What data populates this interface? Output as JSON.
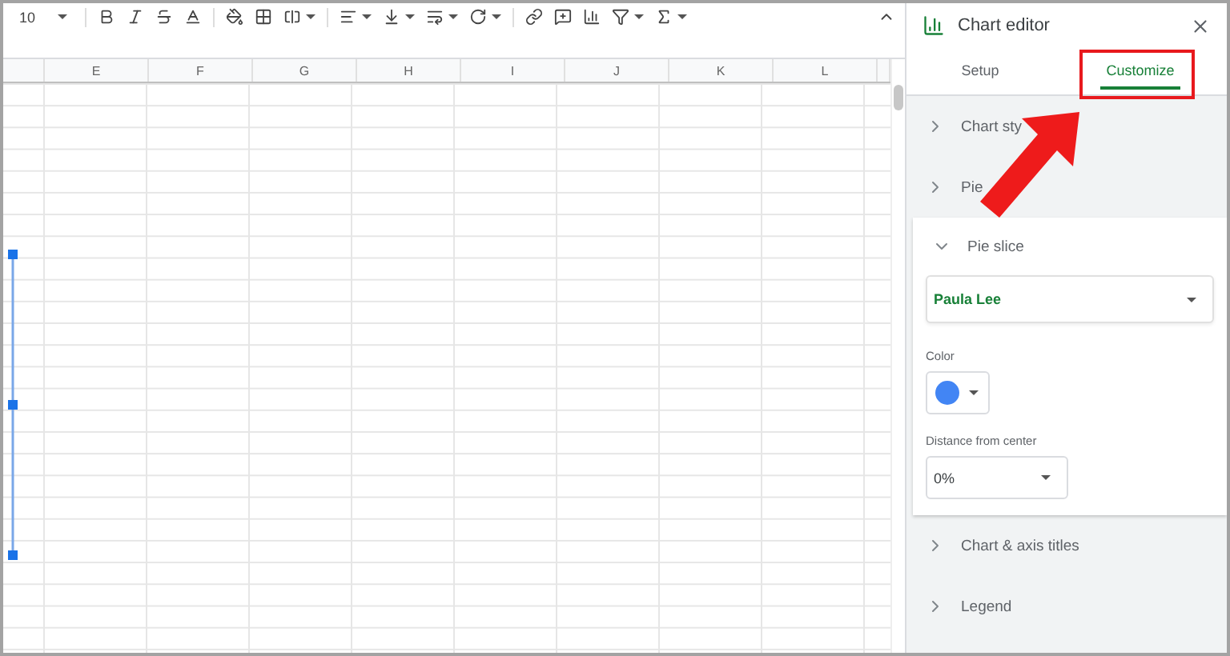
{
  "toolbar": {
    "font_size": "10"
  },
  "columns": [
    "E",
    "F",
    "G",
    "H",
    "I",
    "J",
    "K",
    "L"
  ],
  "chart_editor": {
    "title": "Chart editor",
    "tabs": [
      {
        "label": "Setup",
        "selected": false
      },
      {
        "label": "Customize",
        "selected": true
      }
    ],
    "sections": [
      {
        "kind": "collapsed",
        "title": "Chart sty",
        "expanded": false
      },
      {
        "kind": "collapsed",
        "title": "Pie",
        "expanded": false
      },
      {
        "kind": "slice",
        "title": "Pie slice",
        "expanded": true,
        "series": "Paula Lee",
        "color_label": "Color",
        "color": "#4285f4",
        "distance_label": "Distance from center",
        "distance": "0%"
      },
      {
        "kind": "collapsed",
        "title": "Chart & axis titles",
        "expanded": false
      },
      {
        "kind": "collapsed",
        "title": "Legend",
        "expanded": false
      }
    ]
  }
}
